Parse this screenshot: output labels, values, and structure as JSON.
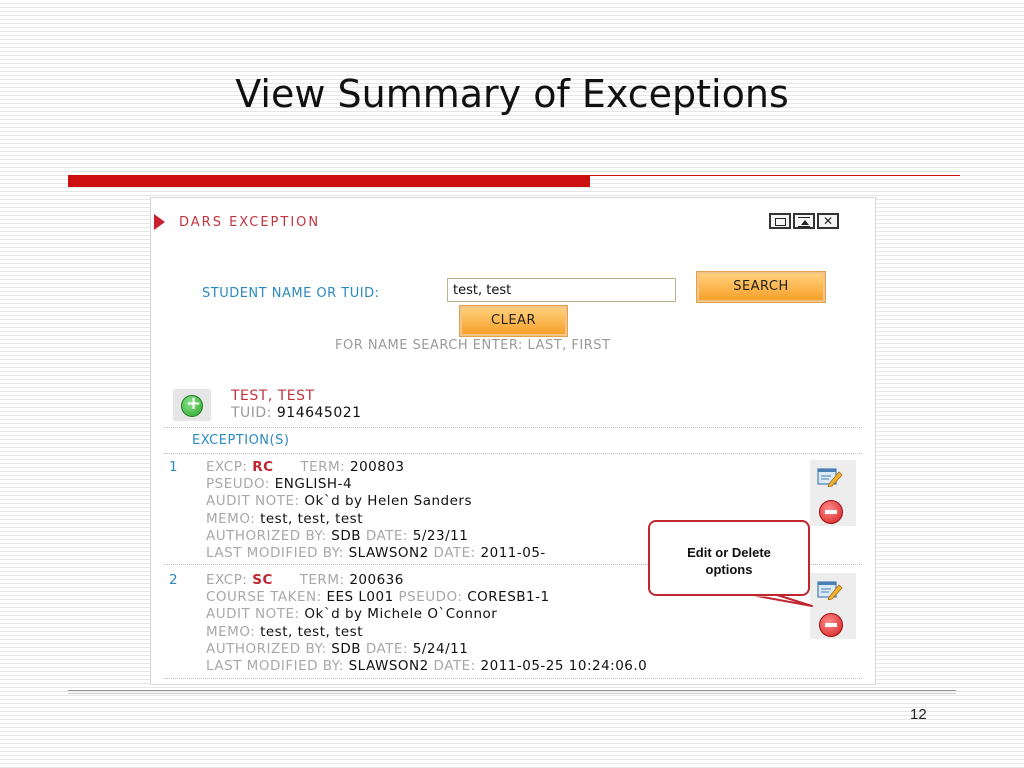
{
  "slide": {
    "title": "View Summary of Exceptions",
    "page_number": "12"
  },
  "panel": {
    "title": "DARS EXCEPTION",
    "search_label": "STUDENT NAME OR TUID:",
    "search_value": "test, test",
    "search_button": "SEARCH",
    "clear_button": "CLEAR",
    "hint": "FOR NAME SEARCH ENTER: LAST, FIRST"
  },
  "student": {
    "name": "TEST, TEST",
    "tuid_label": "TUID:",
    "tuid": "914645021"
  },
  "exceptions_title": "EXCEPTION(S)",
  "exceptions": [
    {
      "num": "1",
      "excp_label": "EXCP:",
      "excp": "RC",
      "term_label": "TERM:",
      "term": "200803",
      "pseudo_label": "PSEUDO:",
      "pseudo": "ENGLISH-4",
      "audit_label": "AUDIT NOTE:",
      "audit": "Ok`d by Helen Sanders",
      "memo_label": "MEMO:",
      "memo": "test, test, test",
      "auth_label": "AUTHORIZED BY:",
      "auth": "SDB",
      "date_label": "DATE:",
      "date": "5/23/11",
      "modified_label": "LAST MODIFIED BY:",
      "modified": "SLAWSON2",
      "mod_date_label": "DATE:",
      "mod_date": "2011-05-"
    },
    {
      "num": "2",
      "excp_label": "EXCP:",
      "excp": "SC",
      "term_label": "TERM:",
      "term": "200636",
      "course_label": "COURSE TAKEN:",
      "course": "EES  L001",
      "pseudo_label": "PSEUDO:",
      "pseudo": "CORESB1-1",
      "audit_label": "AUDIT NOTE:",
      "audit": "Ok`d by Michele O`Connor",
      "memo_label": "MEMO:",
      "memo": "test, test, test",
      "auth_label": "AUTHORIZED BY:",
      "auth": "SDB",
      "date_label": "DATE:",
      "date": "5/24/11",
      "modified_label": "LAST MODIFIED BY:",
      "modified": "SLAWSON2",
      "mod_date_label": "DATE:",
      "mod_date": "2011-05-25 10:24:06.0"
    }
  ],
  "callout": {
    "line1": "Edit or Delete",
    "line2": "options"
  },
  "icons": [
    "minimize-icon",
    "restore-icon",
    "close-icon",
    "add-icon",
    "edit-icon",
    "delete-icon"
  ],
  "colors": {
    "accent_red": "#cc1010",
    "label_blue": "#2c8ac0",
    "button_orange": "#f7a12a"
  }
}
